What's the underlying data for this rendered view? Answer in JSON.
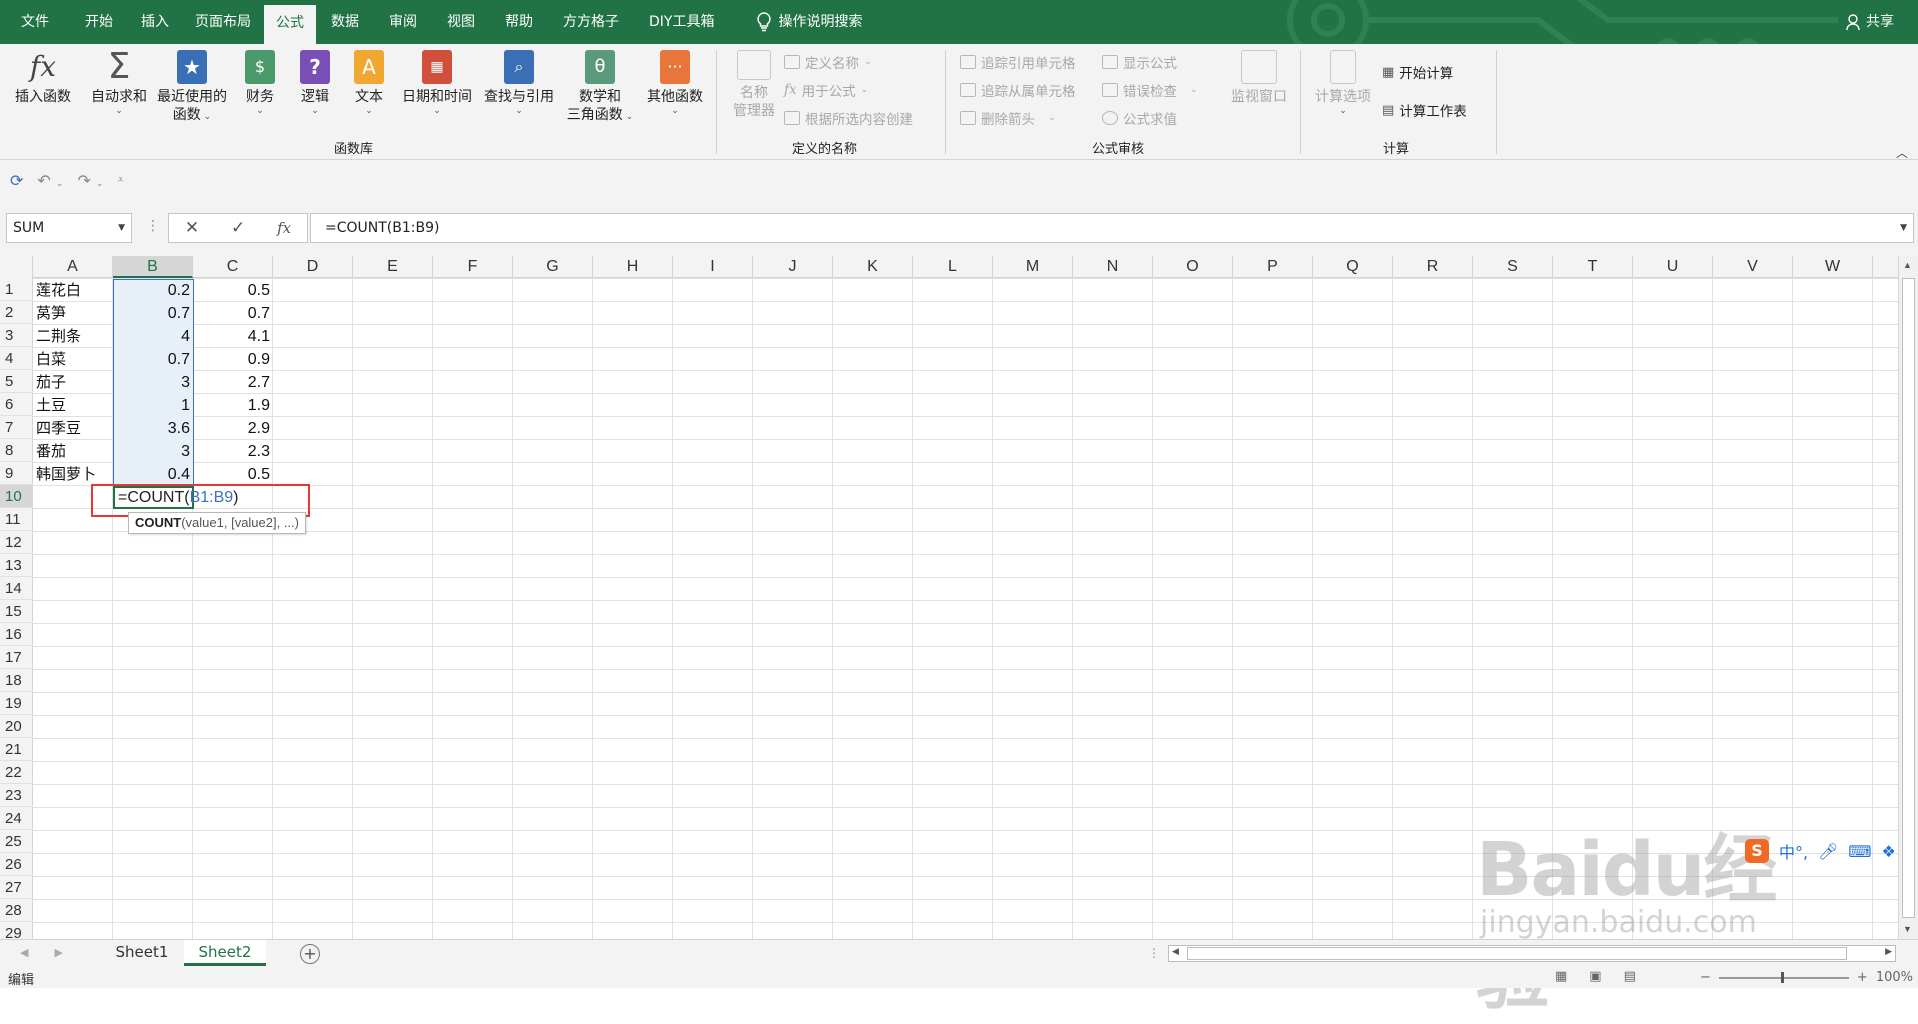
{
  "menu": {
    "tabs": [
      "文件",
      "开始",
      "插入",
      "页面布局",
      "公式",
      "数据",
      "审阅",
      "视图",
      "帮助",
      "方方格子",
      "DIY工具箱"
    ],
    "active_tab": "公式",
    "tell_me": "操作说明搜索",
    "share": "共享"
  },
  "ribbon": {
    "function_library": {
      "insert_function": "插入函数",
      "autosum": "自动求和",
      "recent_1": "最近使用的",
      "recent_2": "函数",
      "financial": "财务",
      "logical": "逻辑",
      "text": "文本",
      "datetime": "日期和时间",
      "lookup": "查找与引用",
      "math_1": "数学和",
      "math_2": "三角函数",
      "more": "其他函数",
      "group_label": "函数库"
    },
    "defined_names": {
      "name_manager_1": "名称",
      "name_manager_2": "管理器",
      "define_name": "定义名称",
      "use_in_formula": "用于公式",
      "create_from_selection": "根据所选内容创建",
      "group_label": "定义的名称"
    },
    "formula_auditing": {
      "trace_precedents": "追踪引用单元格",
      "trace_dependents": "追踪从属单元格",
      "remove_arrows": "删除箭头",
      "show_formulas": "显示公式",
      "error_checking": "错误检查",
      "evaluate_formula": "公式求值",
      "watch_window": "监视窗口",
      "group_label": "公式审核"
    },
    "calculation": {
      "calc_options": "计算选项",
      "calc_now": "开始计算",
      "calc_sheet": "计算工作表",
      "group_label": "计算"
    }
  },
  "formula_bar": {
    "name_box": "SUM",
    "formula": "=COUNT(B1:B9)"
  },
  "grid": {
    "columns": [
      "A",
      "B",
      "C",
      "D",
      "E",
      "F",
      "G",
      "H",
      "I",
      "J",
      "K",
      "L",
      "M",
      "N",
      "O",
      "P",
      "Q",
      "R",
      "S",
      "T",
      "U",
      "V",
      "W"
    ],
    "rows": [
      "1",
      "2",
      "3",
      "4",
      "5",
      "6",
      "7",
      "8",
      "9",
      "10",
      "11",
      "12",
      "13",
      "14",
      "15",
      "16",
      "17",
      "18",
      "19",
      "20",
      "21",
      "22",
      "23",
      "24",
      "25",
      "26",
      "27",
      "28",
      "29"
    ],
    "data": [
      {
        "a": "莲花白",
        "b": "0.2",
        "c": "0.5"
      },
      {
        "a": "莴笋",
        "b": "0.7",
        "c": "0.7"
      },
      {
        "a": "二荆条",
        "b": "4",
        "c": "4.1"
      },
      {
        "a": "白菜",
        "b": "0.7",
        "c": "0.9"
      },
      {
        "a": "茄子",
        "b": "3",
        "c": "2.7"
      },
      {
        "a": "土豆",
        "b": "1",
        "c": "1.9"
      },
      {
        "a": "四季豆",
        "b": "3.6",
        "c": "2.9"
      },
      {
        "a": "番茄",
        "b": "3",
        "c": "2.3"
      },
      {
        "a": "韩国萝卜",
        "b": "0.4",
        "c": "0.5"
      }
    ],
    "editing_cell": {
      "prefix": "=COUNT(",
      "ref": "B1:B9",
      "suffix": ")"
    },
    "tooltip": {
      "fn": "COUNT",
      "args": "(value1, [value2], ...)"
    }
  },
  "sheets": [
    "Sheet1",
    "Sheet2"
  ],
  "active_sheet": "Sheet2",
  "status": {
    "mode": "编辑",
    "zoom": "100%"
  },
  "watermark": {
    "brand": "Baidu经验",
    "url": "jingyan.baidu.com"
  },
  "colors": {
    "excel_green": "#217346",
    "range_blue": "#3c70c0",
    "highlight_red": "#e53935"
  }
}
